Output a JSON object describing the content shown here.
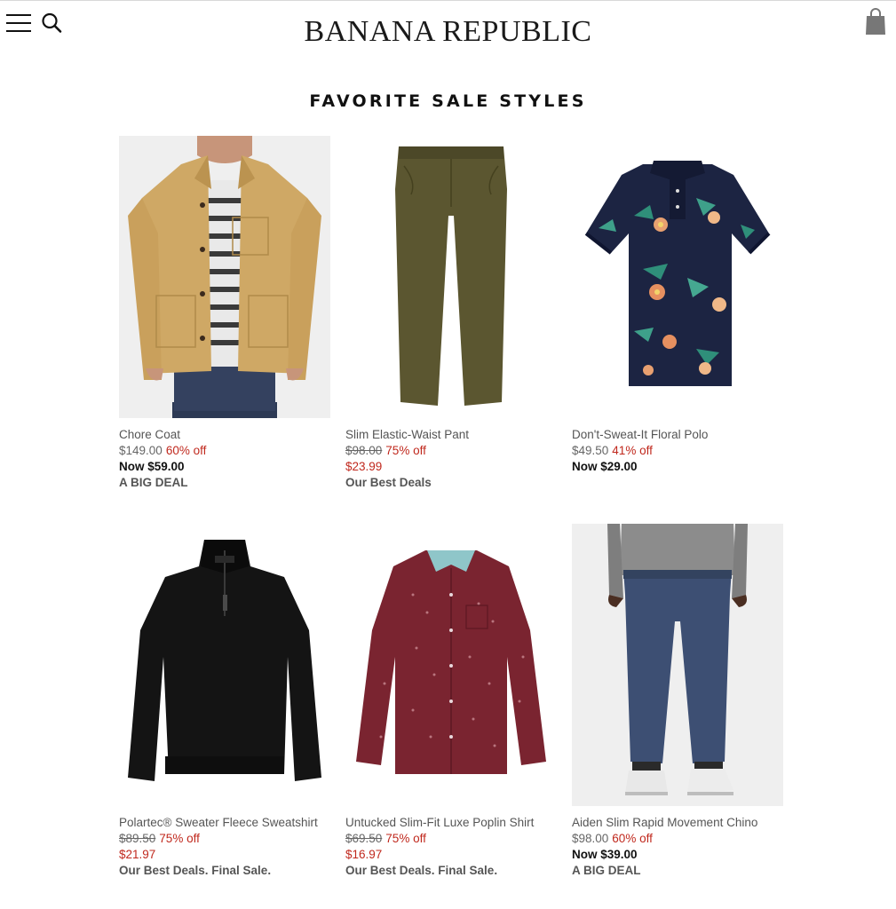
{
  "header": {
    "brand": "BANANA REPUBLIC",
    "icons": {
      "menu": "hamburger-menu-icon",
      "search": "search-icon",
      "bag": "shopping-bag-icon"
    }
  },
  "section": {
    "title": "FAVORITE SALE STYLES"
  },
  "colors": {
    "sale_red": "#c0281d",
    "text_dark": "#111111",
    "text_gray": "#555555"
  },
  "products": [
    {
      "name": "Chore Coat",
      "original_price": "$149.00",
      "discount": "60% off",
      "now_price": "Now $59.00",
      "promo": "A BIG DEAL"
    },
    {
      "name": "Slim Elastic-Waist Pant",
      "original_price": "$98.00",
      "discount": "75% off",
      "sale_price": "$23.99",
      "promo": "Our Best Deals"
    },
    {
      "name": "Don't-Sweat-It Floral Polo",
      "original_price": "$49.50",
      "discount": "41% off",
      "now_price": "Now $29.00"
    },
    {
      "name": "Polartec® Sweater Fleece Sweatshirt",
      "original_price": "$89.50",
      "discount": "75% off",
      "sale_price": "$21.97",
      "promo": "Our Best Deals. Final Sale."
    },
    {
      "name": "Untucked Slim-Fit Luxe Poplin Shirt",
      "original_price": "$69.50",
      "discount": "75% off",
      "sale_price": "$16.97",
      "promo": "Our Best Deals. Final Sale."
    },
    {
      "name": "Aiden Slim Rapid Movement Chino",
      "original_price": "$98.00",
      "discount": "60% off",
      "now_price": "Now $39.00",
      "promo": "A BIG DEAL"
    }
  ]
}
